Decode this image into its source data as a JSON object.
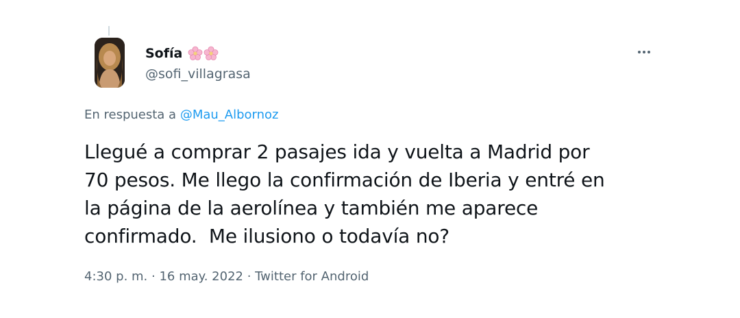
{
  "author": {
    "display_name": "Sofía",
    "handle": "@sofi_villagrasa",
    "name_emoji": [
      "cherry-blossom-icon",
      "cherry-blossom-icon"
    ]
  },
  "reply": {
    "prefix": "En respuesta a ",
    "mention": "@Mau_Albornoz"
  },
  "tweet": {
    "lines": [
      "Llegué a comprar 2 pasajes ida y vuelta a Madrid por",
      "70 pesos. Me llego la confirmación de Iberia y entré en",
      "la página de la aerolínea y también me aparece",
      "confirmado.  Me ilusiono o todavía no?"
    ]
  },
  "meta": {
    "time": "4:30 p. m.",
    "separator": " · ",
    "date": "16 may. 2022",
    "source": "Twitter for Android"
  },
  "colors": {
    "link": "#1d9bf0",
    "secondary_text": "#536471",
    "primary_text": "#0f1419"
  }
}
